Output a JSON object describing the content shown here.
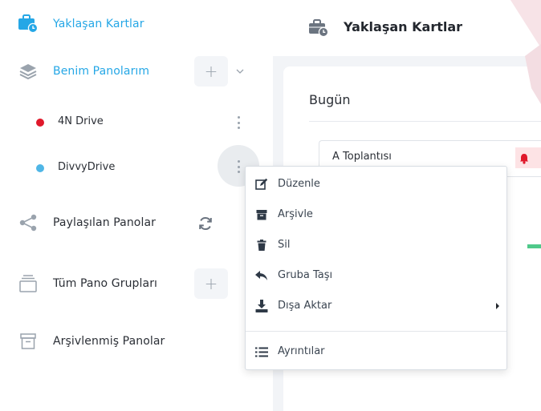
{
  "sidebar": {
    "upcoming": {
      "label": "Yaklaşan Kartlar",
      "icon": "briefcase-clock-icon",
      "color": "#25a7e6"
    },
    "my_boards": {
      "label": "Benim Panolarım",
      "icon": "layers-icon",
      "add": "+",
      "boards": [
        {
          "label": "4N Drive",
          "color": "#e0192b"
        },
        {
          "label": "DivvyDrive",
          "color": "#4fb6e6"
        }
      ]
    },
    "shared": {
      "label": "Paylaşılan Panolar",
      "icon": "share-icon"
    },
    "groups": {
      "label": "Tüm Pano Grupları",
      "icon": "tray-icon",
      "add": "+"
    },
    "archived": {
      "label": "Arşivlenmiş Panolar",
      "icon": "archive-box-icon"
    }
  },
  "main": {
    "title": "Yaklaşan Kartlar",
    "section": "Bugün",
    "task": {
      "title": "A Toplantısı",
      "badge_icon": "bell-icon",
      "badge_color": "#fde3e5"
    }
  },
  "menu": {
    "items": [
      {
        "label": "Düzenle",
        "icon": "edit-icon"
      },
      {
        "label": "Arşivle",
        "icon": "archive-icon"
      },
      {
        "label": "Sil",
        "icon": "trash-icon"
      },
      {
        "label": "Gruba Taşı",
        "icon": "move-reply-icon"
      },
      {
        "label": "Dışa Aktar",
        "icon": "download-icon"
      }
    ],
    "details": {
      "label": "Ayrıntılar",
      "icon": "list-icon"
    }
  }
}
